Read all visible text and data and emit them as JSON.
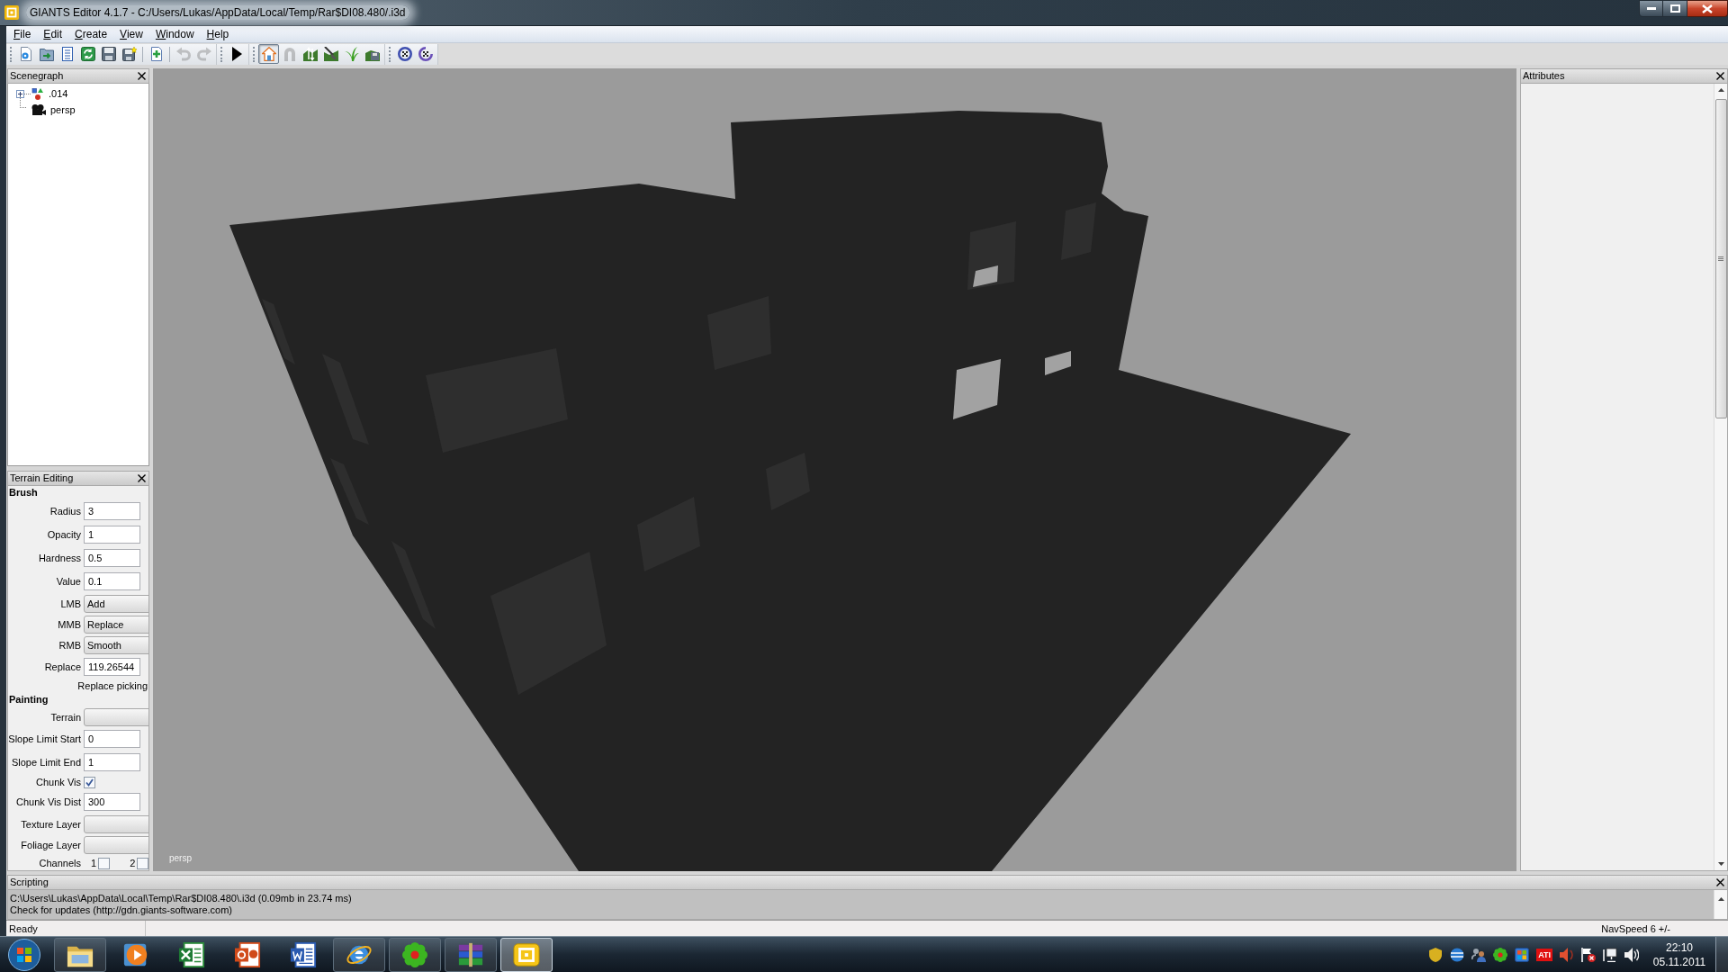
{
  "window": {
    "title": "GIANTS Editor 4.1.7 - C:/Users/Lukas/AppData/Local/Temp/Rar$DI08.480/.i3d"
  },
  "menu": [
    "File",
    "Edit",
    "Create",
    "View",
    "Window",
    "Help"
  ],
  "toolbars": [
    {
      "groups": [
        [
          {
            "kind": "new",
            "disabled": false,
            "selected": false
          },
          {
            "kind": "open",
            "disabled": false,
            "selected": false
          },
          {
            "kind": "list",
            "disabled": false,
            "selected": false
          },
          {
            "kind": "reload",
            "disabled": false,
            "selected": false
          },
          {
            "kind": "save",
            "disabled": false,
            "selected": false
          },
          {
            "kind": "saveas",
            "disabled": false,
            "selected": false
          }
        ],
        [
          {
            "kind": "add",
            "disabled": false,
            "selected": false
          }
        ],
        [
          {
            "kind": "undo",
            "disabled": true,
            "selected": false
          },
          {
            "kind": "redo",
            "disabled": true,
            "selected": false
          }
        ]
      ]
    },
    {
      "groups": [
        [
          {
            "kind": "play",
            "disabled": false,
            "selected": false
          }
        ]
      ]
    },
    {
      "groups": [
        [
          {
            "kind": "home",
            "disabled": false,
            "selected": true
          },
          {
            "kind": "magnet",
            "disabled": true,
            "selected": false
          },
          {
            "kind": "raise",
            "disabled": false,
            "selected": false
          },
          {
            "kind": "smooth",
            "disabled": false,
            "selected": false
          },
          {
            "kind": "foliage",
            "disabled": false,
            "selected": false
          },
          {
            "kind": "terrainsave",
            "disabled": false,
            "selected": false
          }
        ]
      ]
    },
    {
      "groups": [
        [
          {
            "kind": "gizmo",
            "disabled": false,
            "selected": false
          },
          {
            "kind": "gizmo2",
            "disabled": false,
            "selected": false
          }
        ]
      ]
    }
  ],
  "scenegraph": {
    "title": "Scenegraph",
    "nodes": [
      {
        "label": ".014",
        "kind": "transform",
        "expanded": false
      },
      {
        "label": "persp",
        "kind": "camera"
      }
    ]
  },
  "terrain_editing": {
    "title": "Terrain Editing",
    "sections": [
      {
        "heading": "Brush",
        "rows": [
          {
            "kind": "input",
            "label": "Radius",
            "value": "3"
          },
          {
            "kind": "input",
            "label": "Opacity",
            "value": "1"
          },
          {
            "kind": "input",
            "label": "Hardness",
            "value": "0.5"
          },
          {
            "kind": "input",
            "label": "Value",
            "value": "0.1"
          },
          {
            "kind": "combo",
            "label": "LMB",
            "value": "Add"
          },
          {
            "kind": "combo",
            "label": "MMB",
            "value": "Replace"
          },
          {
            "kind": "combo",
            "label": "RMB",
            "value": "Smooth"
          },
          {
            "kind": "input",
            "label": "Replace",
            "value": "119.26544"
          },
          {
            "kind": "action",
            "label": "Replace picking"
          }
        ]
      },
      {
        "heading": "Painting",
        "rows": [
          {
            "kind": "combo",
            "label": "Terrain"
          },
          {
            "kind": "input",
            "label": "Slope Limit Start",
            "value": "0"
          },
          {
            "kind": "input",
            "label": "Slope Limit End",
            "value": "1"
          },
          {
            "kind": "checkbox",
            "label": "Chunk Vis",
            "checked": true
          },
          {
            "kind": "input",
            "label": "Chunk Vis Dist",
            "value": "300"
          },
          {
            "kind": "combo",
            "label": "Texture Layer"
          },
          {
            "kind": "combo",
            "label": "Foliage Layer"
          },
          {
            "kind": "checks",
            "label": "Channels",
            "options": [
              {
                "label": "1",
                "checked": false
              },
              {
                "label": "2",
                "checked": false
              }
            ]
          }
        ]
      }
    ]
  },
  "viewport": {
    "camera_label": "persp"
  },
  "attributes": {
    "title": "Attributes"
  },
  "scripting": {
    "title": "Scripting",
    "lines": [
      "C:\\Users\\Lukas\\AppData\\Local\\Temp\\Rar$DI08.480\\.i3d (0.09mb in 23.74 ms)",
      "Check for updates (http://gdn.giants-software.com)"
    ]
  },
  "status_bar": {
    "message": "Ready",
    "nav_speed": "NavSpeed 6 +/-"
  },
  "taskbar": {
    "apps": [
      {
        "kind": "explorer",
        "running": true,
        "selected": false
      },
      {
        "kind": "player",
        "running": false,
        "selected": false
      },
      {
        "kind": "sheet",
        "running": false,
        "selected": false
      },
      {
        "kind": "slides",
        "running": false,
        "selected": false
      },
      {
        "kind": "doc",
        "running": false,
        "selected": false
      },
      {
        "kind": "browser",
        "running": true,
        "selected": false
      },
      {
        "kind": "messenger",
        "running": true,
        "selected": false
      },
      {
        "kind": "archive",
        "running": true,
        "selected": false
      },
      {
        "kind": "editor",
        "running": true,
        "selected": true
      }
    ],
    "tray": [
      {
        "kind": "shield"
      },
      {
        "kind": "globe"
      },
      {
        "kind": "people"
      },
      {
        "kind": "flower"
      },
      {
        "kind": "update"
      },
      {
        "kind": "badge",
        "label": "ATI"
      },
      {
        "kind": "speaker"
      },
      {
        "kind": "flag"
      },
      {
        "kind": "network"
      },
      {
        "kind": "volume"
      }
    ],
    "clock": {
      "time": "22:10",
      "date": "05.11.2011"
    }
  }
}
